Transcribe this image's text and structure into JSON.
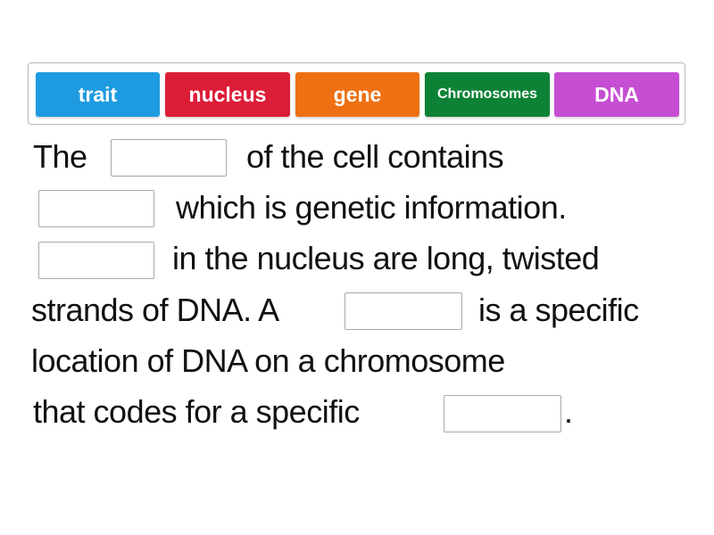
{
  "word_bank": [
    {
      "label": "trait",
      "color": "#1e9be0"
    },
    {
      "label": "nucleus",
      "color": "#dc1d38"
    },
    {
      "label": "gene",
      "color": "#ee7012"
    },
    {
      "label": "Chromosomes",
      "color": "#0d8236"
    },
    {
      "label": "DNA",
      "color": "#c64ed2"
    }
  ],
  "text": {
    "l1a": "The",
    "l1b": "of the cell contains",
    "l2": "which is genetic information.",
    "l3": "in the nucleus are long, twisted",
    "l4a": "strands of DNA. A",
    "l4b": "is a specific",
    "l5": "location of DNA on a chromosome",
    "l6a": "that codes for a specific",
    "l6b": "."
  }
}
